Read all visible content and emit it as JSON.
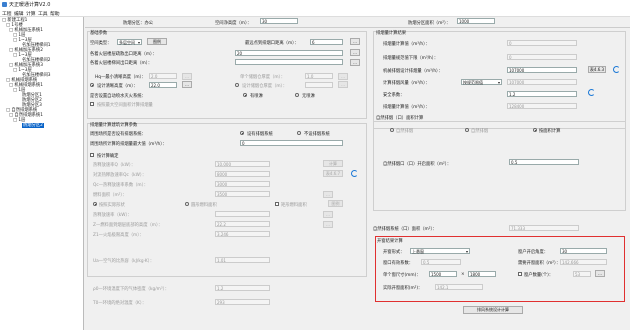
{
  "window": {
    "title": "天正暖通计算V2.0"
  },
  "menu": [
    "工程",
    "编辑",
    "计算",
    "工具",
    "帮助"
  ],
  "tree": [
    "□ 新建工程1",
    "□ 1号楼",
    "□ 机械加压系统1",
    "□ 1层",
    "□ 1~3层",
    "名加压楼梯间1",
    "□ 机械加压系统2",
    "□ 1~3层",
    "名加压楼梯间2",
    "□ 机械加压系统3",
    "□ 1~3层",
    "名加压楼梯间3",
    "□ 机械排烟系统",
    "□ 机械排烟系统1",
    "□ 1层",
    "防烟分区1",
    "防烟分区2",
    "防烟分区3",
    "□ 自然排烟系统",
    "□ 自然排烟系统1",
    "□ 1层",
    "防烟分区2"
  ],
  "top": {
    "area_label": "防烟分区：办公",
    "height_label": "空间净高度（m）：",
    "height_value": "30",
    "fire_area_label": "防烟分区面积（m²）：",
    "fire_area_value": "1000"
  },
  "basic": {
    "title": "基础参数",
    "space_type_label": "空间类型：",
    "space_type_value": "多层空间",
    "fig_button": "图例",
    "dist_label": "最远点到排烟口距离（m）：",
    "dist_value": "6",
    "row2_label": "各着火层楼层疏散出口距离（m）：",
    "row2_value": "20",
    "row3_label": "各着火层楼梯间出口距离（m）：",
    "row3_value": "",
    "hq_label": "Hq—最小清晰高度（m）：",
    "hq_value": "2.0",
    "single_label": "单个储烟仓厚度（m）：",
    "single_value": "1.0",
    "design_h_label": "设计清晰高度（m）：",
    "design_h_value": "22.0",
    "design_thk_label": "设计储烟仓厚度（m）：",
    "design_thk_value": "",
    "sprinkler_q": "是否设置自动喷水灭火系统：",
    "sprinkler_yes": "有喷淋",
    "sprinkler_no": "无喷淋",
    "sprinkler_note": "按照最大空间面积计算排烟量"
  },
  "calc": {
    "title": "排烟量计算建筑计算参数",
    "q1_label": "周围场所是否设有排烟系统：",
    "q1_yes": "设有排烟系统",
    "q1_no": "不设排烟系统",
    "q2_label": "周围场所计算的排烟量最大值（m³/h）：",
    "q2_value": "0",
    "radio_calc": "按计算确定",
    "fields": [
      {
        "label": "热释放速率Q（kW）：",
        "value": "10,000"
      },
      {
        "label": "对流热释放速率Qc（kW）：",
        "value": "8000"
      },
      {
        "label": "Qc—热释放速率系数（m）：",
        "value": "3000"
      },
      {
        "label": "燃料面积（m²）：",
        "value": "3500"
      }
    ],
    "check_btn": "计算",
    "table_btn": "表4.6.7",
    "shape_label": "燃料面积形状",
    "shape_a": "按照实际形状",
    "shape_b": "圆形燃料面积",
    "shape_c": "矩形燃料面积",
    "f5_label": "热释放速率（kW）：",
    "f5_value": "",
    "f6_label": "Z—燃料面到烟层底部的高度（m）：",
    "f6_value": "22.2",
    "f7_label": "Z1—火焰极限高度（m）：",
    "f7_value": "3.246",
    "g1_label": "Ua—空气的比热容（kJ/kg·K）：",
    "g1_value": "1.01",
    "g2_label": "ρ0—环境温度下的气体密度（kg/m³）：",
    "g2_value": "1.2",
    "g3_label": "T0—环境的绝对温度（K）：",
    "g3_value": "293"
  },
  "right": {
    "title": "排烟量计算结果",
    "r1_label": "排烟量计算值（m³/h）：",
    "r1_value": "0",
    "r2_label": "排烟量规范值下限（m³/h）：",
    "r2_value": "0",
    "r3_label": "机械排烟设计排烟量（m³/h）：",
    "r3_value": "107000",
    "r3_btn": "表4.6.3",
    "r4_label": "计算排烟风量（m³/h）：",
    "r4_select": "按规范限值",
    "r4_value": "107000",
    "r5_label": "安全系数：",
    "r5_value": "1.2",
    "r6_label": "排烟量计算值（m³/h）：",
    "r6_value": "128400",
    "natural_title": "自然排烟（口）面积计算",
    "nat_a": "自然排烟",
    "nat_b": "自然排烟",
    "nat_c": "按风速计算",
    "nat_c2": "按面积计算",
    "nat_label": "自然排烟口（口）开启面积（m²）：",
    "nat_value": "0.5",
    "vent_label": "自然排烟系统（口）面积（m²）：",
    "vent_value": "71.333",
    "result_title": "开窗结果计算",
    "window_type_label": "开窗形式：",
    "window_type_value": "上悬窗",
    "window_ratio_label": "窗户开启角度：",
    "window_ratio_value": "30",
    "eff_label": "窗口有效系数：",
    "eff_value": "0.5",
    "need_label": "需要开窗面积（m²）：",
    "need_value": "142.666",
    "size_label": "单个窗尺寸(mm)：",
    "size_w": "1500",
    "size_x": "×",
    "size_h": "1800",
    "count_label": "窗户数量(个)：",
    "count_value": "53",
    "actual_label": "实际开窗面积(m²)：",
    "actual_value": "142.1",
    "bottom_btn": "排风系统设计计算"
  }
}
